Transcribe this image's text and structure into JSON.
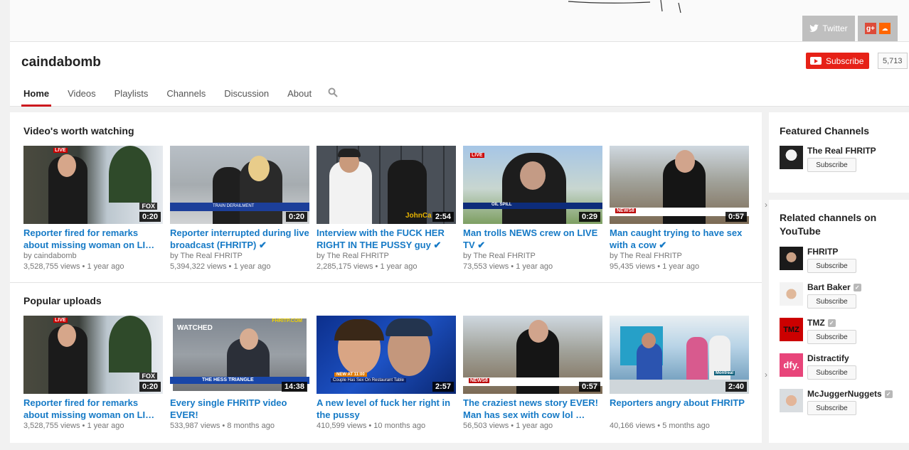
{
  "social": {
    "twitter_label": "Twitter"
  },
  "channel": {
    "name": "caindabomb",
    "subscribe_label": "Subscribe",
    "subscriber_count": "5,713"
  },
  "tabs": [
    "Home",
    "Videos",
    "Playlists",
    "Channels",
    "Discussion",
    "About"
  ],
  "shelves": [
    {
      "title": "Video's worth watching",
      "videos": [
        {
          "title": "Reporter fired for remarks about missing woman on LI…",
          "by": "by caindabomb",
          "views": "3,528,755 views",
          "age": "1 year ago",
          "duration": "0:20"
        },
        {
          "title": "Reporter interrupted during live broadcast (FHRITP) ✔",
          "by": "by The Real FHRITP",
          "views": "5,394,322 views",
          "age": "1 year ago",
          "duration": "0:20"
        },
        {
          "title": "Interview with the FUCK HER RIGHT IN THE PUSSY guy ✔",
          "by": "by The Real FHRITP",
          "views": "2,285,175 views",
          "age": "1 year ago",
          "duration": "2:54"
        },
        {
          "title": "Man trolls NEWS crew on LIVE TV ✔",
          "by": "by The Real FHRITP",
          "views": "73,553 views",
          "age": "1 year ago",
          "duration": "0:29"
        },
        {
          "title": "Man caught trying to have sex with a cow ✔",
          "by": "by The Real FHRITP",
          "views": "95,435 views",
          "age": "1 year ago",
          "duration": "0:57"
        }
      ]
    },
    {
      "title": "Popular uploads",
      "videos": [
        {
          "title": "Reporter fired for remarks about missing woman on LI…",
          "views": "3,528,755 views",
          "age": "1 year ago",
          "duration": "0:20"
        },
        {
          "title": "Every single FHRITP video EVER!",
          "views": "533,987 views",
          "age": "8 months ago",
          "duration": "14:38"
        },
        {
          "title": "A new level of fuck her right in the pussy",
          "views": "410,599 views",
          "age": "10 months ago",
          "duration": "2:57"
        },
        {
          "title": "The craziest news story EVER! Man has sex with cow lol …",
          "views": "56,503 views",
          "age": "1 year ago",
          "duration": "0:57"
        },
        {
          "title": "Reporters angry about FHRITP",
          "views": "40,166 views",
          "age": "5 months ago",
          "duration": "2:40"
        }
      ]
    }
  ],
  "featured": {
    "title": "Featured Channels",
    "channels": [
      {
        "name": "The Real FHRITP",
        "subscribe": "Subscribe"
      }
    ]
  },
  "related": {
    "title": "Related channels on YouTube",
    "channels": [
      {
        "name": "FHRITP",
        "subscribe": "Subscribe",
        "verified": false
      },
      {
        "name": "Bart Baker",
        "subscribe": "Subscribe",
        "verified": true
      },
      {
        "name": "TMZ",
        "subscribe": "Subscribe",
        "verified": true
      },
      {
        "name": "Distractify",
        "subscribe": "Subscribe",
        "verified": false
      },
      {
        "name": "McJuggerNuggets",
        "subscribe": "Subscribe",
        "verified": true
      }
    ]
  },
  "thumb_text": {
    "fox": "FOX",
    "live": "LIVE",
    "johncain": "JohnCa",
    "oil_spill": "OIL SPILL",
    "news8": "NEWS8",
    "watched": "WATCHED",
    "fhritp_com": "FHRITP.COM",
    "hess": "THE HESS TRIANGLE",
    "new_at": "NEW AT 11:00",
    "restaurant": "Couple Has Sex On Restaurant Table",
    "montreal": "Montreal",
    "tmz": "TMZ",
    "dfy": "dfy."
  }
}
